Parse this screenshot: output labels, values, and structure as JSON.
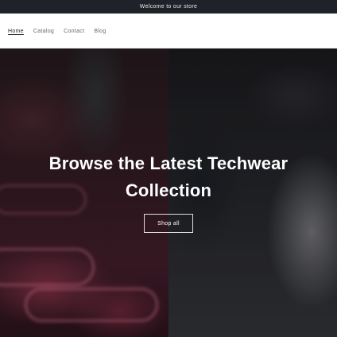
{
  "announcement": {
    "text": "Welcome to our store"
  },
  "nav": {
    "items": [
      {
        "label": "Home",
        "active": true
      },
      {
        "label": "Catalog",
        "active": false
      },
      {
        "label": "Contact",
        "active": false
      },
      {
        "label": "Blog",
        "active": false
      }
    ]
  },
  "hero": {
    "title": "Browse the Latest Techwear Collection",
    "button_label": "Shop all"
  },
  "colors": {
    "announcement_bg": "#1f2228",
    "header_bg": "#ffffff",
    "hero_text": "#ffffff"
  }
}
